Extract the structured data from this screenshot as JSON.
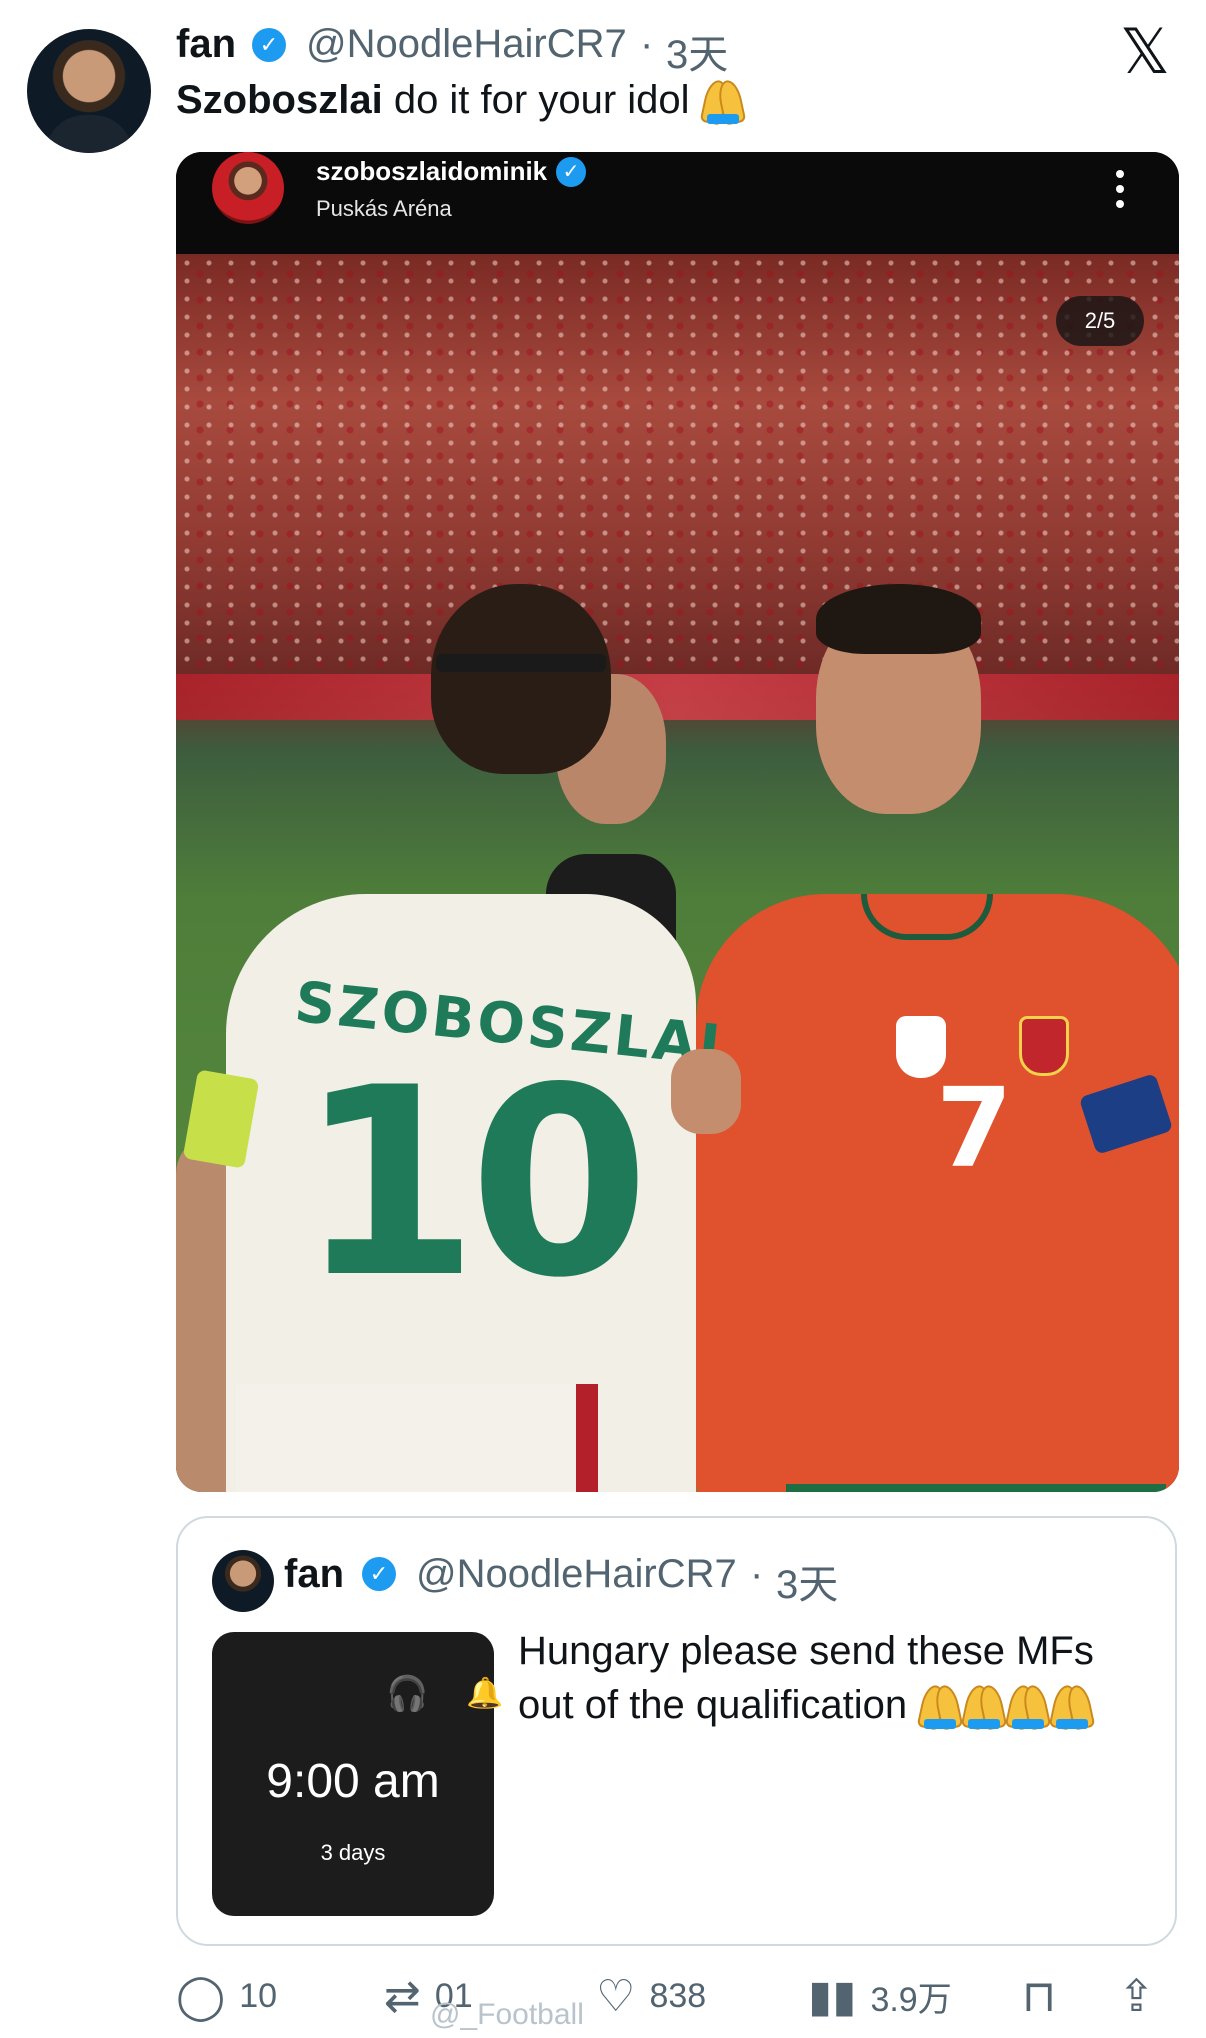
{
  "tweet": {
    "author_name": "fan",
    "handle": "@NoodleHairCR7",
    "separator": "·",
    "time": "3天",
    "text_bold": "Szoboszlai",
    "text_rest": " do it for your idol "
  },
  "app": {
    "logo": "𝕏"
  },
  "media": {
    "ig_username": "szoboszlaidominik",
    "ig_location": "Puskás Aréna",
    "counter": "2/5",
    "jersey_left_name": "SZOBOSZLAI",
    "jersey_left_number": "10",
    "jersey_right_number": "7"
  },
  "quote": {
    "author_name": "fan",
    "handle": "@NoodleHairCR7",
    "separator": "·",
    "time": "3天",
    "thumb_time": "9:00 am",
    "thumb_days": "3 days",
    "text": "Hungary please send these MFs out of the qualification "
  },
  "actions": {
    "replies": "10",
    "reposts": "01",
    "likes": "838",
    "views": "3.9万"
  },
  "watermark": "@_Football",
  "icons": {
    "verified": "verified-badge-icon",
    "emoji": "folded-hands-icon",
    "reply": "reply-icon",
    "repost": "repost-icon",
    "like": "heart-icon",
    "views": "views-icon",
    "bookmark": "bookmark-icon",
    "share": "share-icon"
  },
  "colors": {
    "accent": "#1d9bf0",
    "text": "#0f1419",
    "muted": "#536471",
    "border": "#cfd9de"
  }
}
